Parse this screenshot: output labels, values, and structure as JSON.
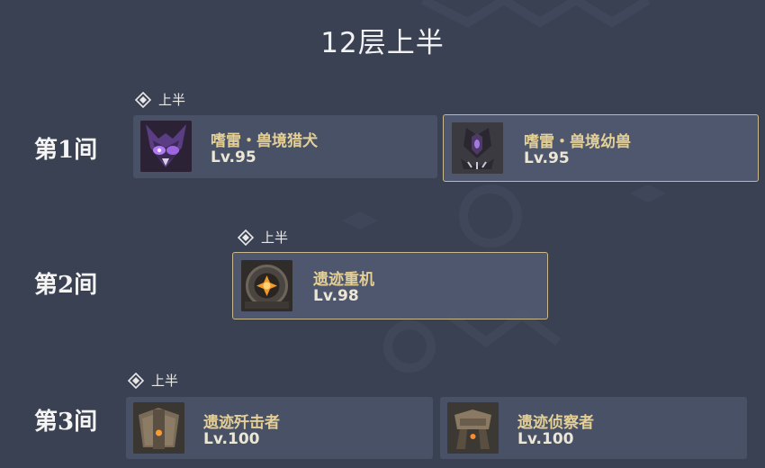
{
  "title": "12层上半",
  "chambers": [
    {
      "label": "第1间",
      "half_label": "上半",
      "enemies": [
        {
          "name": "嗜雷・兽境猎犬",
          "level": "Lv.95",
          "icon": "rifthound-icon"
        },
        {
          "name": "嗜雷・兽境幼兽",
          "level": "Lv.95",
          "icon": "rifthound-whelp-icon"
        }
      ]
    },
    {
      "label": "第2间",
      "half_label": "上半",
      "enemies": [
        {
          "name": "遗迹重机",
          "level": "Lv.98",
          "icon": "ruin-grader-icon"
        }
      ]
    },
    {
      "label": "第3间",
      "half_label": "上半",
      "enemies": [
        {
          "name": "遗迹歼击者",
          "level": "Lv.100",
          "icon": "ruin-destroyer-icon"
        },
        {
          "name": "遗迹侦察者",
          "level": "Lv.100",
          "icon": "ruin-scout-icon"
        }
      ]
    }
  ],
  "colors": {
    "background": "#3a4152",
    "card": "#4e586e",
    "name_gold": "#e4cf95",
    "selected_border": "#c9b98c"
  }
}
